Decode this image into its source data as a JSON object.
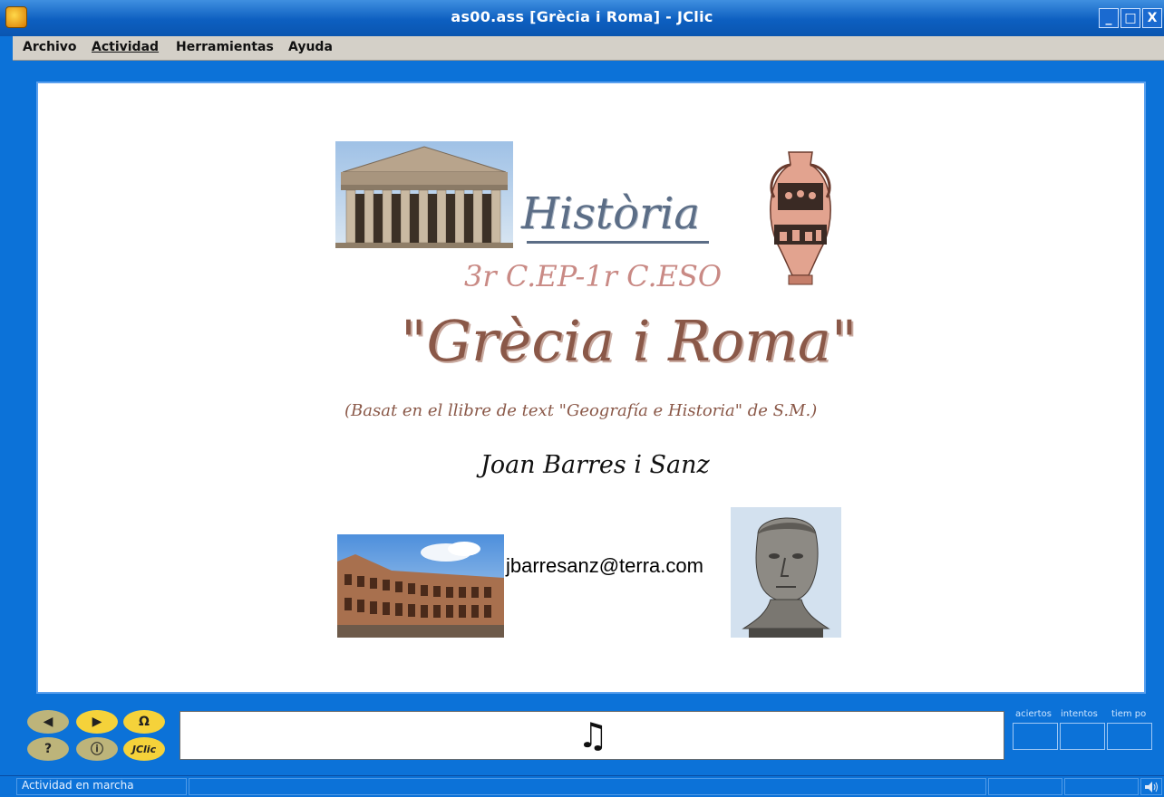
{
  "window": {
    "title": "as00.ass [Grècia i Roma] - JClic",
    "controls": [
      "_",
      "□",
      "X"
    ]
  },
  "menubar": {
    "items": [
      {
        "label": "Archivo",
        "key": "A"
      },
      {
        "label": "Actividad",
        "key": "A"
      },
      {
        "label": "Herramientas",
        "key": "H"
      },
      {
        "label": "Ayuda",
        "key": "y"
      }
    ]
  },
  "activity": {
    "subject": "Història",
    "level": "3r C.EP-1r C.ESO",
    "title": "\"Grècia i Roma\"",
    "source_note": "(Basat en el llibre de text \"Geografía e Historia\" de S.M.)",
    "author": "Joan Barres i Sanz",
    "email": "jbarresanz@terra.com",
    "images": [
      "parthenon",
      "greek-amphora",
      "colosseum",
      "caesar-bust"
    ]
  },
  "controls": {
    "prev_icon": "◀",
    "next_icon": "▶",
    "restart_icon": "Ω",
    "help_icon": "?",
    "info_icon": "ⓘ",
    "jclic_label": "JClic",
    "message_icon": "♫"
  },
  "counters": {
    "aciertos_label": "aciertos",
    "intentos_label": "intentos",
    "tiempo_label": "tiem po"
  },
  "status": {
    "text": "Actividad en marcha",
    "sound_icon": "speaker-icon"
  },
  "colors": {
    "titlebar": "#0d5fc0",
    "frame": "#0c72d8",
    "menubar": "#d4d0c8",
    "historia_text": "#5b6d86",
    "brown_text": "#8a5848",
    "pink_text": "#c98a85",
    "yellow_btn": "#f5d23a",
    "olive_btn": "#bdb47a"
  }
}
